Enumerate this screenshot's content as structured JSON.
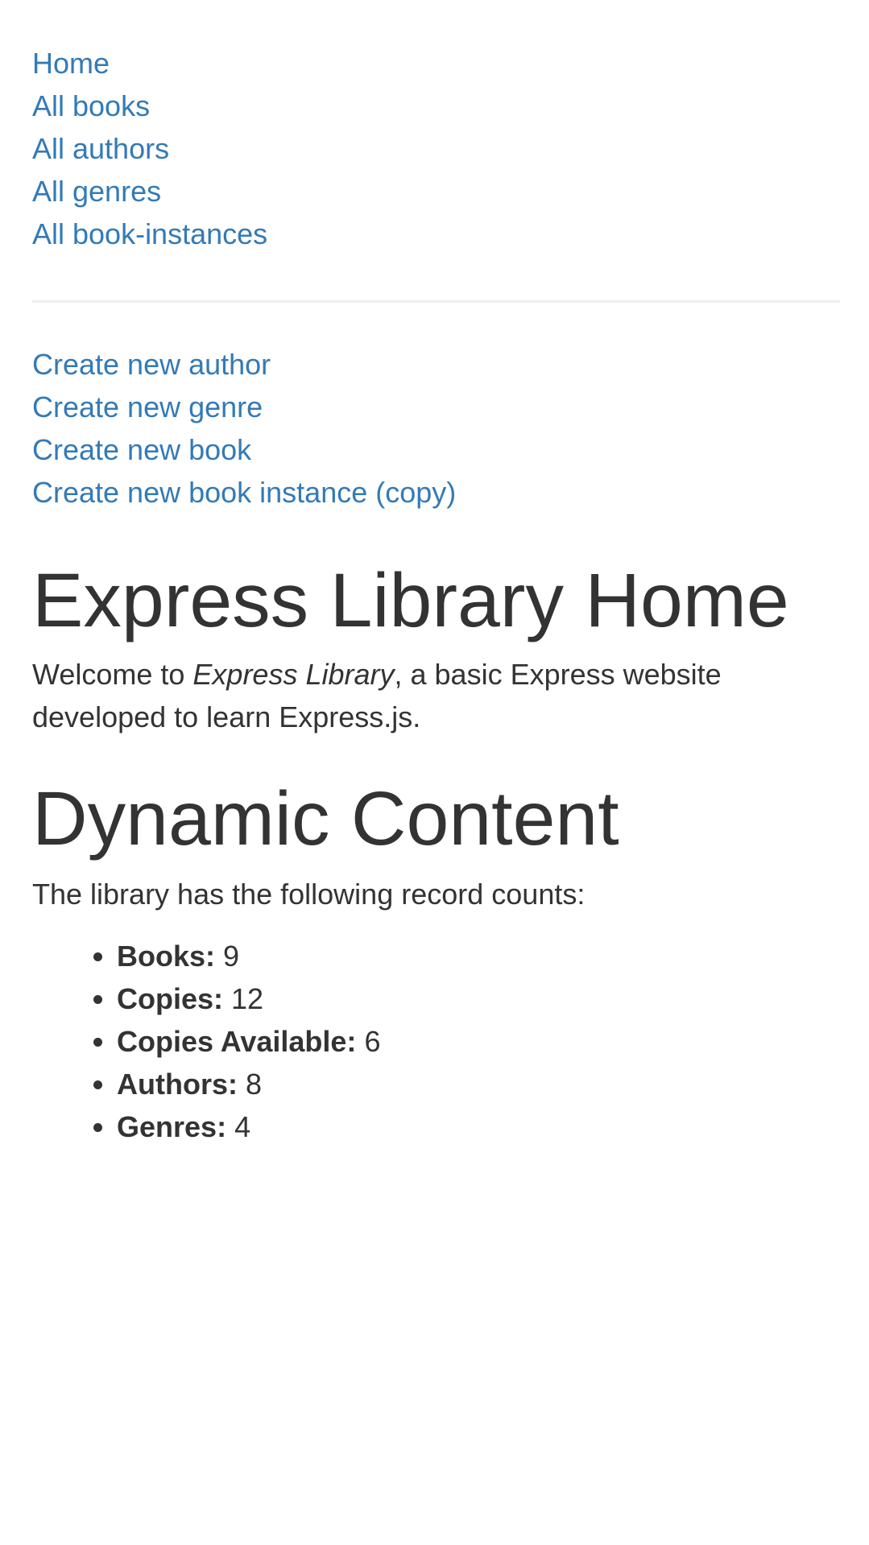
{
  "nav": {
    "main": [
      {
        "label": "Home"
      },
      {
        "label": "All books"
      },
      {
        "label": "All authors"
      },
      {
        "label": "All genres"
      },
      {
        "label": "All book-instances"
      }
    ],
    "create": [
      {
        "label": "Create new author"
      },
      {
        "label": "Create new genre"
      },
      {
        "label": "Create new book"
      },
      {
        "label": "Create new book instance (copy)"
      }
    ]
  },
  "content": {
    "title": "Express Library Home",
    "intro": {
      "before": "Welcome to ",
      "emphasis": "Express Library",
      "after": ", a basic Express website developed to learn Express.js."
    },
    "dynamic_title": "Dynamic Content",
    "counts_intro": "The library has the following record counts:",
    "counts": [
      {
        "label": "Books:",
        "value": "9"
      },
      {
        "label": "Copies:",
        "value": "12"
      },
      {
        "label": "Copies Available:",
        "value": "6"
      },
      {
        "label": "Authors:",
        "value": "8"
      },
      {
        "label": "Genres:",
        "value": "4"
      }
    ]
  },
  "colors": {
    "link": "#337ab7",
    "text": "#333333",
    "divider": "#eeeeee"
  }
}
